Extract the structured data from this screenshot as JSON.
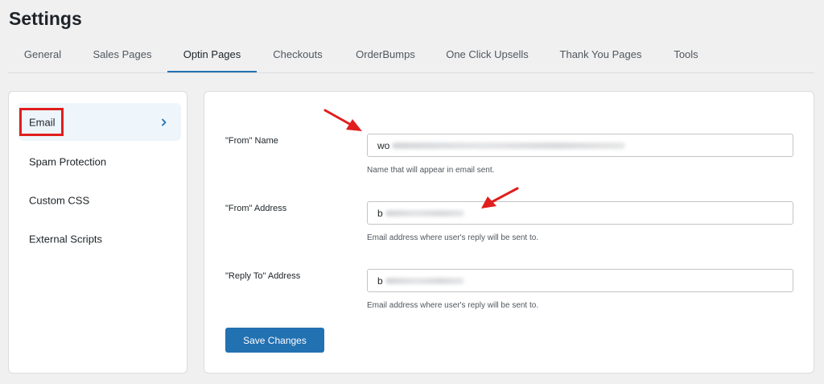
{
  "page": {
    "title": "Settings"
  },
  "tabs": [
    {
      "label": "General"
    },
    {
      "label": "Sales Pages"
    },
    {
      "label": "Optin Pages",
      "active": true
    },
    {
      "label": "Checkouts"
    },
    {
      "label": "OrderBumps"
    },
    {
      "label": "One Click Upsells"
    },
    {
      "label": "Thank You Pages"
    },
    {
      "label": "Tools"
    }
  ],
  "sidebar": {
    "items": [
      {
        "label": "Email",
        "active": true
      },
      {
        "label": "Spam Protection"
      },
      {
        "label": "Custom CSS"
      },
      {
        "label": "External Scripts"
      }
    ]
  },
  "form": {
    "from_name": {
      "label": "\"From\" Name",
      "value": "wo",
      "help": "Name that will appear in email sent."
    },
    "from_address": {
      "label": "\"From\" Address",
      "value": "b",
      "help": "Email address where user's reply will be sent to."
    },
    "reply_to": {
      "label": "\"Reply To\" Address",
      "value": "b",
      "help": "Email address where user's reply will be sent to."
    },
    "save_label": "Save Changes"
  },
  "colors": {
    "accent": "#2271b1",
    "annotation": "#e01e1e",
    "active_side_bg": "#eef6fc"
  },
  "icons": {
    "sidebar_active": "chevron-right-icon"
  }
}
